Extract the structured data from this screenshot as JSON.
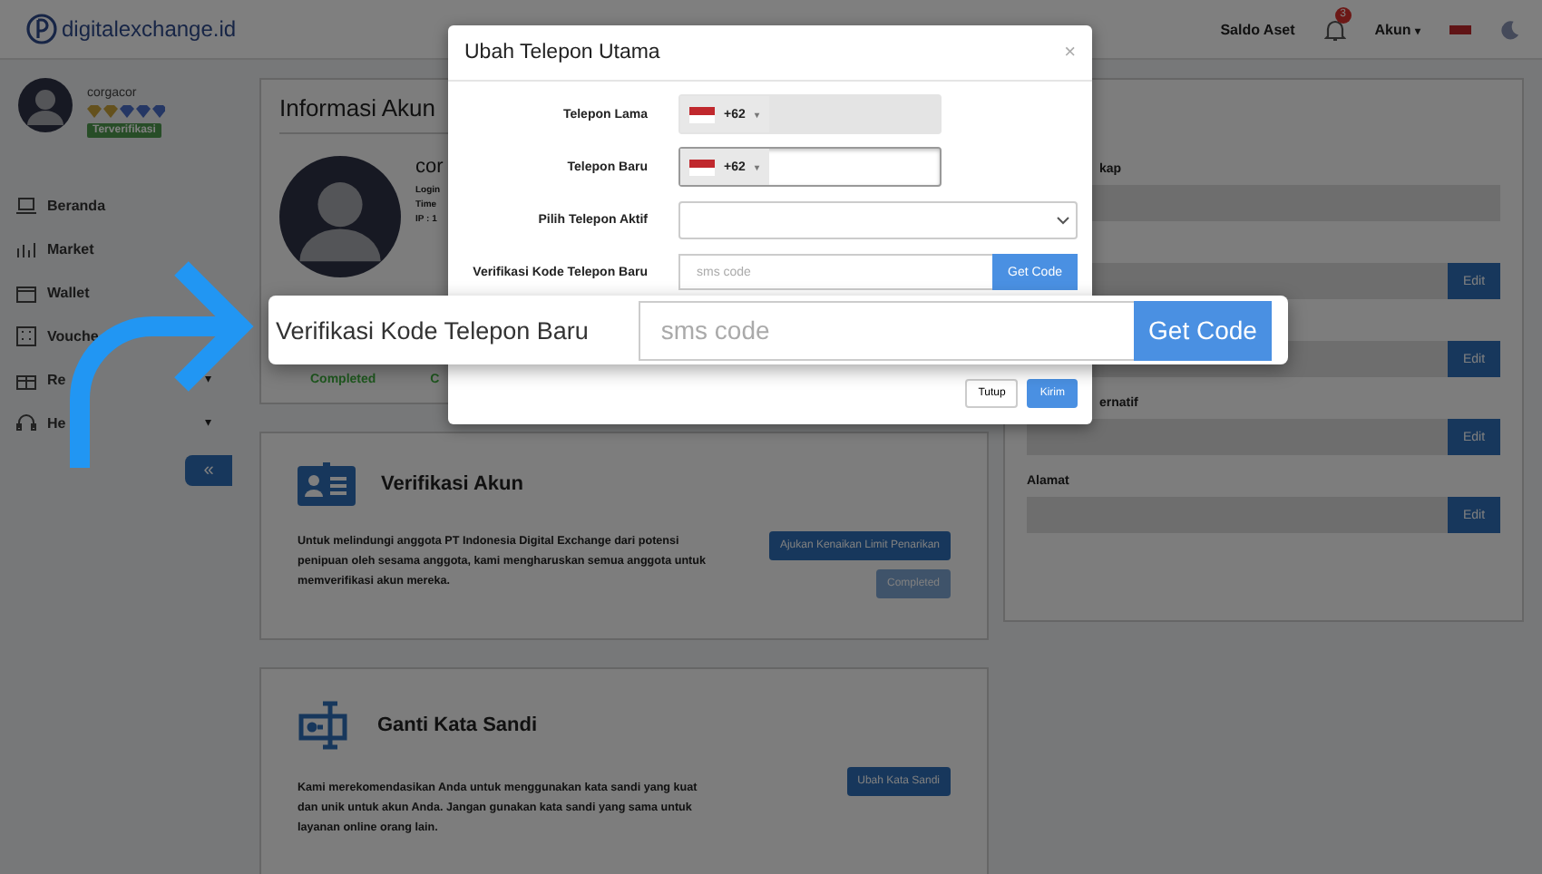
{
  "header": {
    "logo": "digitalexchange.id",
    "balance_link": "Saldo Aset",
    "notification_count": "3",
    "account_menu": "Akun",
    "account_caret": "▾"
  },
  "sidebar": {
    "username": "corgacor",
    "verified_badge": "Terverifikasi",
    "items": [
      {
        "label": "Beranda",
        "kind": "laptop"
      },
      {
        "label": "Market",
        "kind": "chart"
      },
      {
        "label": "Wallet",
        "kind": "wallet"
      },
      {
        "label": "Vouche",
        "kind": "voucher"
      },
      {
        "label": "Re",
        "kind": "gift",
        "caret": "▾"
      },
      {
        "label": "He",
        "kind": "headset",
        "caret": "▾"
      }
    ],
    "collapse_button": "«"
  },
  "account_info": {
    "title": "Informasi Akun",
    "name": "cor",
    "details": [
      "Login",
      "Time",
      "IP : 1"
    ],
    "statuses": [
      "Completed",
      "C"
    ]
  },
  "verification": {
    "title": "Verifikasi Akun",
    "text": "Untuk melindungi anggota PT Indonesia Digital Exchange dari potensi penipuan oleh sesama anggota, kami mengharuskan semua anggota untuk memverifikasi akun mereka.",
    "buttons": [
      {
        "label": "Ajukan Kenaikan Limit Penarikan",
        "disabled": false
      },
      {
        "label": "Completed",
        "disabled": true
      }
    ]
  },
  "password": {
    "title": "Ganti Kata Sandi",
    "text": "Kami merekomendasikan Anda untuk menggunakan kata sandi yang kuat dan unik untuk akun Anda. Jangan gunakan kata sandi yang sama untuk layanan online orang lain.",
    "button": "Ubah Kata Sandi"
  },
  "profile_fields": [
    {
      "label": "kap"
    },
    {
      "editable": true,
      "edit_label": "Edit"
    },
    {
      "editable": true,
      "edit_label": "Edit"
    },
    {
      "label": "ernatif",
      "editable": true,
      "edit_label": "Edit"
    },
    {
      "label": "Alamat",
      "editable": true,
      "edit_label": "Edit"
    }
  ],
  "modal": {
    "title": "Ubah Telepon Utama",
    "close": "×",
    "rows": [
      {
        "label": "Telepon Lama",
        "kind": "phone",
        "code": "+62",
        "caret": "▾",
        "disabled": true
      },
      {
        "label": "Telepon Baru",
        "kind": "phone",
        "code": "+62",
        "caret": "▾",
        "disabled": false
      },
      {
        "label": "Pilih Telepon Aktif",
        "kind": "select"
      },
      {
        "label": "Verifikasi Kode Telepon Baru",
        "kind": "code",
        "placeholder": "sms code",
        "button": "Get Code"
      }
    ],
    "buttons": [
      {
        "label": "Tutup",
        "kind": "secondary"
      },
      {
        "label": "Kirim",
        "kind": "primary"
      }
    ]
  },
  "callout": {
    "label": "Verifikasi Kode Telepon Baru",
    "placeholder": "sms code",
    "button": "Get Code"
  }
}
